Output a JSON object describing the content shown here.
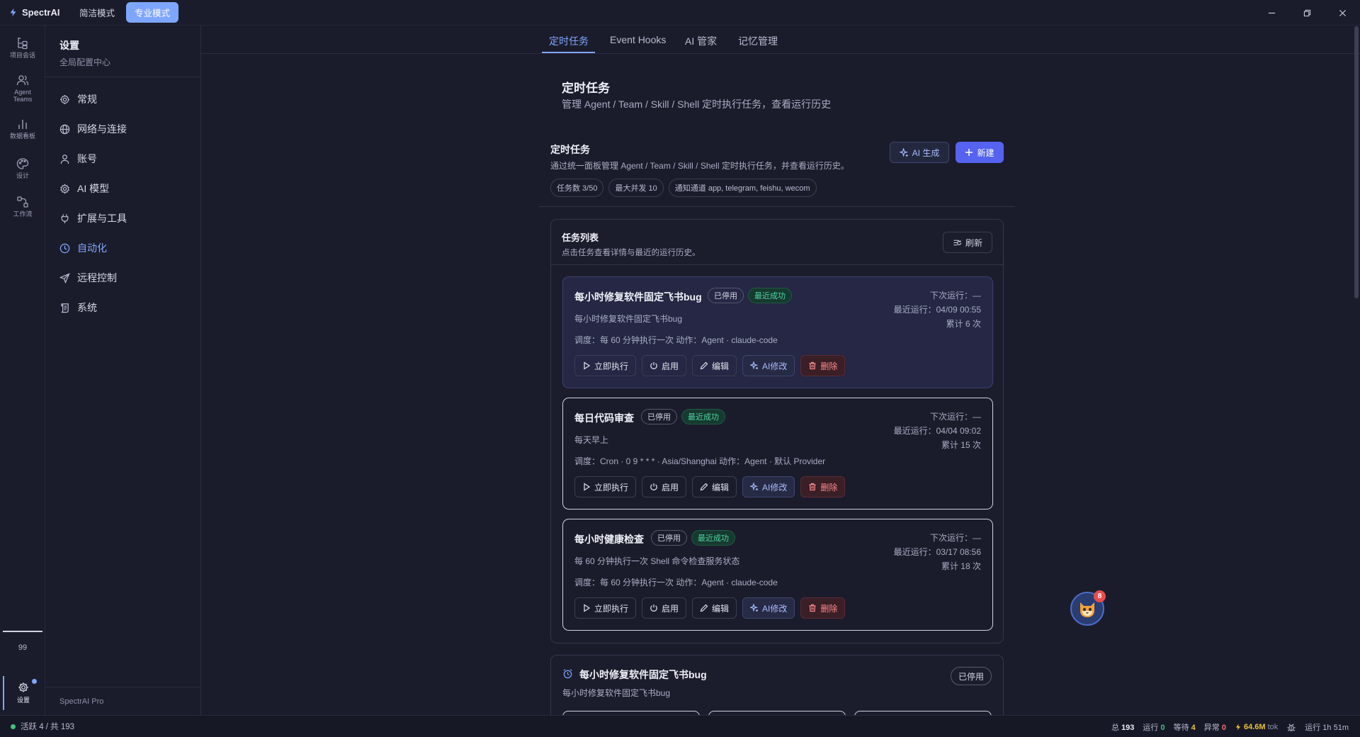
{
  "app": {
    "brand": "SpectrAI",
    "modes": [
      {
        "label": "简洁模式",
        "active": false
      },
      {
        "label": "专业模式",
        "active": true
      }
    ]
  },
  "rail": {
    "items": [
      {
        "label": "项目会话",
        "icon": "project-tree-icon"
      },
      {
        "label": "Agent Teams",
        "icon": "users-icon"
      },
      {
        "label": "数据看板",
        "icon": "bar-chart-icon"
      },
      {
        "label": "设计",
        "icon": "palette-icon"
      },
      {
        "label": "工作流",
        "icon": "workflow-icon"
      }
    ],
    "count": "99",
    "settings_label": "设置"
  },
  "sidebar": {
    "title": "设置",
    "subtitle": "全局配置中心",
    "items": [
      {
        "label": "常规",
        "icon": "gear-icon"
      },
      {
        "label": "网络与连接",
        "icon": "globe-icon"
      },
      {
        "label": "账号",
        "icon": "user-icon"
      },
      {
        "label": "AI 模型",
        "icon": "cpu-icon"
      },
      {
        "label": "扩展与工具",
        "icon": "plug-icon"
      },
      {
        "label": "自动化",
        "icon": "clock-icon",
        "active": true
      },
      {
        "label": "远程控制",
        "icon": "send-icon"
      },
      {
        "label": "系统",
        "icon": "scroll-icon"
      }
    ],
    "footer": "SpectrAI Pro"
  },
  "tabs": [
    {
      "label": "定时任务",
      "active": true
    },
    {
      "label": "Event Hooks"
    },
    {
      "label": "AI 管家"
    },
    {
      "label": "记忆管理"
    }
  ],
  "page": {
    "title": "定时任务",
    "subtitle": "管理 Agent / Team / Skill / Shell 定时执行任务，查看运行历史"
  },
  "section": {
    "title": "定时任务",
    "subtitle": "通过统一面板管理 Agent / Team / Skill / Shell 定时执行任务，并查看运行历史。",
    "chips": [
      "任务数 3/50",
      "最大并发 10",
      "通知通道 app, telegram, feishu, wecom"
    ],
    "ai_button": "AI 生成",
    "new_button": "新建"
  },
  "task_list": {
    "title": "任务列表",
    "subtitle": "点击任务查看详情与最近的运行历史。",
    "refresh": "刷新",
    "actions": {
      "run": "立即执行",
      "enable": "启用",
      "edit": "编辑",
      "ai": "AI修改",
      "delete": "删除"
    },
    "tasks": [
      {
        "name": "每小时修复软件固定飞书bug",
        "status": "已停用",
        "result": "最近成功",
        "desc": "每小时修复软件固定飞书bug",
        "schedule": "调度：每 60 分钟执行一次    动作：Agent · claude-code",
        "next": "下次运行：—",
        "last": "最近运行：04/09 00:55",
        "total": "累计 6 次"
      },
      {
        "name": "每日代码审查",
        "status": "已停用",
        "result": "最近成功",
        "desc": "每天早上",
        "schedule": "调度：Cron · 0 9 * * * · Asia/Shanghai    动作：Agent · 默认 Provider",
        "next": "下次运行：—",
        "last": "最近运行：04/04 09:02",
        "total": "累计 15 次"
      },
      {
        "name": "每小时健康检查",
        "status": "已停用",
        "result": "最近成功",
        "desc": "每 60 分钟执行一次 Shell 命令检查服务状态",
        "schedule": "调度：每 60 分钟执行一次    动作：Agent · claude-code",
        "next": "下次运行：—",
        "last": "最近运行：03/17 08:56",
        "total": "累计 18 次"
      }
    ]
  },
  "detail": {
    "title": "每小时修复软件固定飞书bug",
    "subtitle": "每小时修复软件固定飞书bug",
    "status": "已停用"
  },
  "mascot": {
    "badge": "8"
  },
  "status": {
    "left": "活跃 4 / 共 193",
    "total_label": "总",
    "total": "193",
    "running_label": "运行",
    "running": "0",
    "waiting_label": "等待",
    "waiting": "4",
    "error_label": "异常",
    "error": "0",
    "tokens": "64.6M",
    "tokens_unit": "tok",
    "uptime": "运行 1h 51m"
  },
  "colors": {
    "accent": "#7fa6ff",
    "primary_button": "#5563f0",
    "success": "#4fd3a0",
    "danger": "#ff8a8a",
    "background": "#1b1c2b"
  }
}
